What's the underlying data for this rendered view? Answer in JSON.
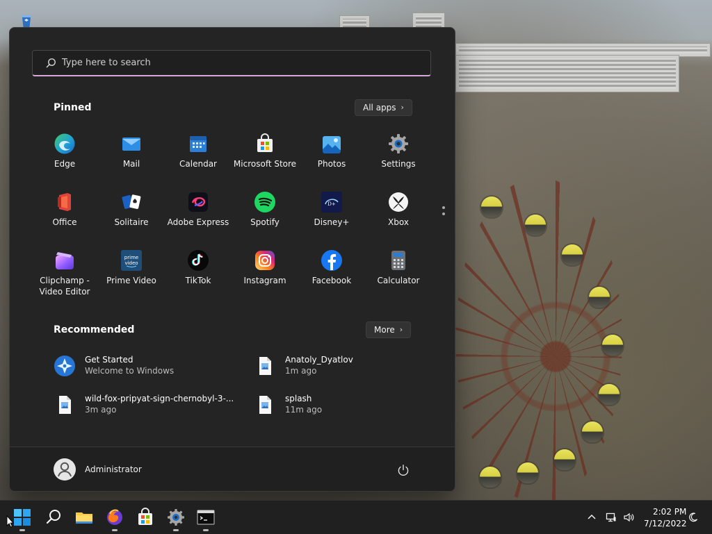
{
  "wallpaper": {
    "theme": "Pripyat ferris wheel"
  },
  "desktop": {
    "icons": [
      {
        "name": "Recycle Bin"
      }
    ]
  },
  "start_menu": {
    "search": {
      "placeholder": "Type here to search"
    },
    "pinned": {
      "title": "Pinned",
      "all_apps_label": "All apps",
      "apps": [
        {
          "label": "Edge",
          "icon": "edge-icon"
        },
        {
          "label": "Mail",
          "icon": "mail-icon"
        },
        {
          "label": "Calendar",
          "icon": "calendar-icon"
        },
        {
          "label": "Microsoft Store",
          "icon": "store-icon"
        },
        {
          "label": "Photos",
          "icon": "photos-icon"
        },
        {
          "label": "Settings",
          "icon": "settings-icon"
        },
        {
          "label": "Office",
          "icon": "office-icon"
        },
        {
          "label": "Solitaire",
          "icon": "solitaire-icon"
        },
        {
          "label": "Adobe Express",
          "icon": "adobe-express-icon"
        },
        {
          "label": "Spotify",
          "icon": "spotify-icon"
        },
        {
          "label": "Disney+",
          "icon": "disney-plus-icon"
        },
        {
          "label": "Xbox",
          "icon": "xbox-icon"
        },
        {
          "label": "Clipchamp - Video Editor",
          "icon": "clipchamp-icon"
        },
        {
          "label": "Prime Video",
          "icon": "prime-video-icon"
        },
        {
          "label": "TikTok",
          "icon": "tiktok-icon"
        },
        {
          "label": "Instagram",
          "icon": "instagram-icon"
        },
        {
          "label": "Facebook",
          "icon": "facebook-icon"
        },
        {
          "label": "Calculator",
          "icon": "calculator-icon"
        }
      ]
    },
    "recommended": {
      "title": "Recommended",
      "more_label": "More",
      "items": [
        {
          "title": "Get Started",
          "subtitle": "Welcome to Windows",
          "icon": "get-started-icon"
        },
        {
          "title": "Anatoly_Dyatlov",
          "subtitle": "1m ago",
          "icon": "image-file-icon"
        },
        {
          "title": "wild-fox-pripyat-sign-chernobyl-3-...",
          "subtitle": "3m ago",
          "icon": "image-file-icon"
        },
        {
          "title": "splash",
          "subtitle": "11m ago",
          "icon": "image-file-icon"
        }
      ]
    },
    "user": {
      "name": "Administrator"
    },
    "power": {
      "icon": "power-icon"
    }
  },
  "taskbar": {
    "items": [
      {
        "name": "start",
        "icon": "windows-start-icon",
        "active": true
      },
      {
        "name": "search",
        "icon": "search-icon",
        "active": false
      },
      {
        "name": "file-explorer",
        "icon": "folder-icon",
        "active": false
      },
      {
        "name": "firefox",
        "icon": "firefox-icon",
        "active": true
      },
      {
        "name": "microsoft-store",
        "icon": "store-icon",
        "active": false
      },
      {
        "name": "settings",
        "icon": "settings-icon",
        "active": true
      },
      {
        "name": "terminal",
        "icon": "terminal-icon",
        "active": true
      }
    ],
    "tray": {
      "icons": [
        "chevron-up-icon",
        "network-icon",
        "volume-icon",
        "do-not-disturb-icon"
      ],
      "time": "2:02 PM",
      "date": "7/12/2022"
    }
  }
}
